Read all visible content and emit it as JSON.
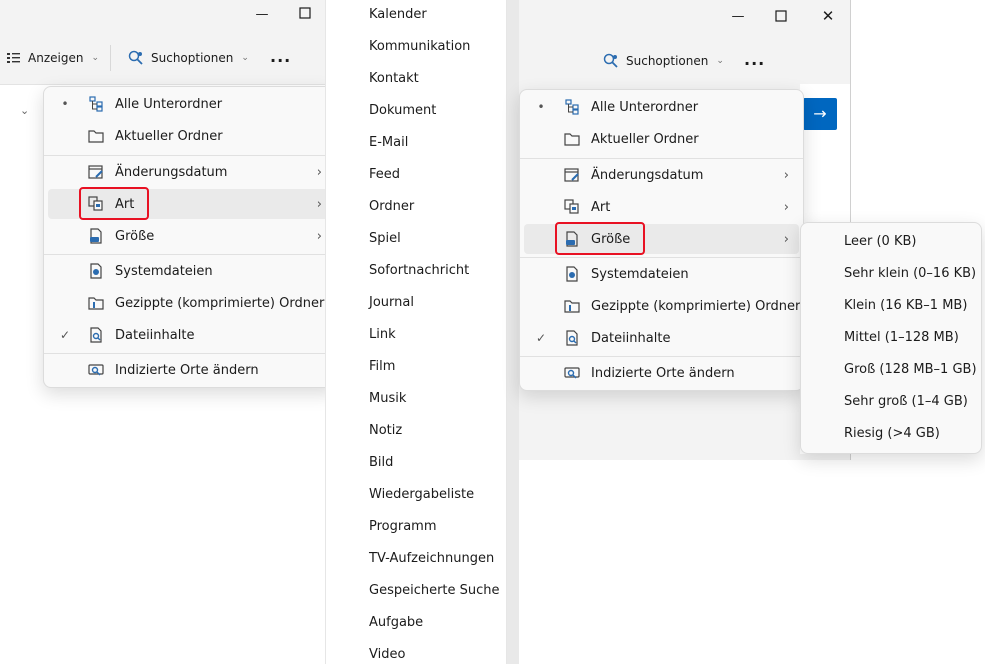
{
  "left_window": {
    "toolbar": {
      "view_label": "Anzeigen",
      "search_options_label": "Suchoptionen",
      "more_label": "..."
    },
    "menu": {
      "items": [
        {
          "label": "Alle Unterordner",
          "mark": "•"
        },
        {
          "label": "Aktueller Ordner",
          "mark": ""
        },
        {
          "label": "Änderungsdatum",
          "mark": ""
        },
        {
          "label": "Art",
          "mark": ""
        },
        {
          "label": "Größe",
          "mark": ""
        },
        {
          "label": "Systemdateien",
          "mark": ""
        },
        {
          "label": "Gezippte (komprimierte) Ordner",
          "mark": ""
        },
        {
          "label": "Dateiinhalte",
          "mark": "✓"
        },
        {
          "label": "Indizierte Orte ändern",
          "mark": ""
        }
      ]
    }
  },
  "type_list": {
    "items": [
      "Kalender",
      "Kommunikation",
      "Kontakt",
      "Dokument",
      "E-Mail",
      "Feed",
      "Ordner",
      "Spiel",
      "Sofortnachricht",
      "Journal",
      "Link",
      "Film",
      "Musik",
      "Notiz",
      "Bild",
      "Wiedergabeliste",
      "Programm",
      "TV-Aufzeichnungen",
      "Gespeicherte Suche",
      "Aufgabe",
      "Video"
    ]
  },
  "right_window": {
    "toolbar": {
      "search_options_label": "Suchoptionen",
      "more_label": "..."
    },
    "menu": {
      "items": [
        {
          "label": "Alle Unterordner",
          "mark": "•"
        },
        {
          "label": "Aktueller Ordner",
          "mark": ""
        },
        {
          "label": "Änderungsdatum",
          "mark": ""
        },
        {
          "label": "Art",
          "mark": ""
        },
        {
          "label": "Größe",
          "mark": ""
        },
        {
          "label": "Systemdateien",
          "mark": ""
        },
        {
          "label": "Gezippte (komprimierte) Ordner",
          "mark": ""
        },
        {
          "label": "Dateiinhalte",
          "mark": "✓"
        },
        {
          "label": "Indizierte Orte ändern",
          "mark": ""
        }
      ]
    },
    "size_submenu": {
      "items": [
        "Leer (0 KB)",
        "Sehr klein (0–16 KB)",
        "Klein (16 KB–1 MB)",
        "Mittel (1–128 MB)",
        "Groß (128 MB–1 GB)",
        "Sehr groß (1–4 GB)",
        "Riesig (>4 GB)"
      ]
    }
  },
  "colors": {
    "accent": "#0067c0",
    "highlight_border": "#e81123"
  },
  "icons": {
    "all-subfolders": "tree-icon",
    "current-folder": "folder-icon",
    "date-modified": "calendar-edit-icon",
    "type": "copy-docs-icon",
    "size": "drive-icon",
    "system-files": "system-file-icon",
    "zipped-folders": "zip-folder-icon",
    "file-contents": "search-doc-icon",
    "indexed-locations": "search-location-icon"
  }
}
